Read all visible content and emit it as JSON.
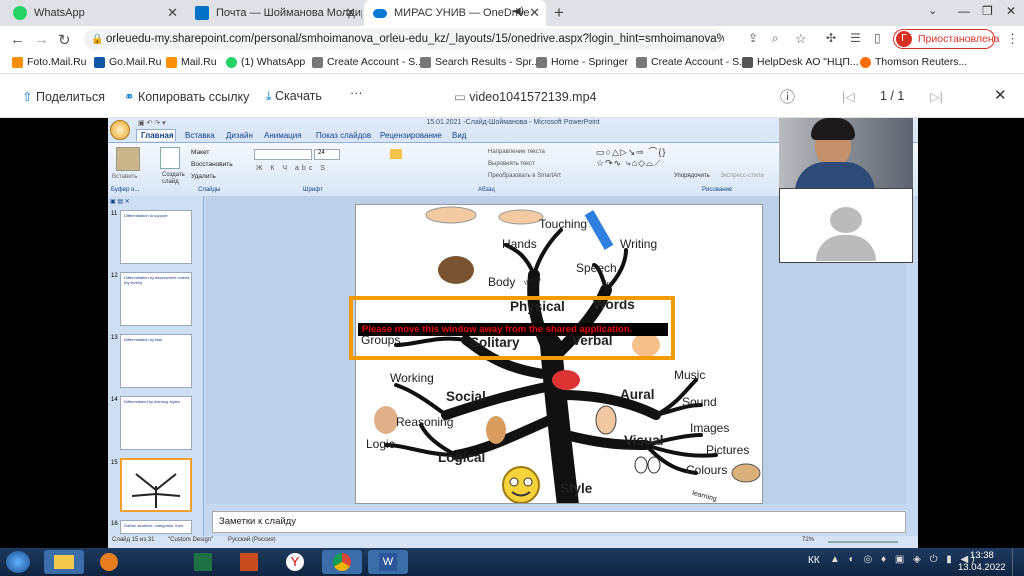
{
  "tabs": [
    {
      "label": "WhatsApp",
      "color": "#25d366"
    },
    {
      "label": "Почта — Шойманова Молдир Е",
      "color": "#0072c6"
    },
    {
      "label": "МИРАС УНИВ — OneDrive",
      "color": "#0078d4"
    }
  ],
  "url": "orleuedu-my.sharepoint.com/personal/smhoimanova_orleu-edu_kz/_layouts/15/onedrive.aspx?login_hint=smhoimanova%40orle...",
  "profile": {
    "initial": "Г",
    "label": "Приостановлена"
  },
  "bookmarks": [
    "Foto.Mail.Ru",
    "Go.Mail.Ru",
    "Mail.Ru",
    "(1) WhatsApp",
    "Create Account - S...",
    "Search Results - Spr...",
    "Home - Springer",
    "Create Account - S...",
    "HelpDesk АО \"НЦП...",
    "Thomson Reuters..."
  ],
  "onedrive": {
    "share": "Поделиться",
    "copy_link": "Копировать ссылку",
    "download": "Скачать",
    "more": "···",
    "filename": "video1041572139.mp4",
    "pager": "1 / 1"
  },
  "ppt": {
    "title": "15.01.2021 -Слайд-Шойманова  -  Microsoft PowerPoint",
    "tabs": [
      "Главная",
      "Вставка",
      "Дизайн",
      "Анимация",
      "Показ слайдов",
      "Рецензирование",
      "Вид"
    ],
    "groups": [
      "Буфер о...",
      "Слайды",
      "Шрифт",
      "Абзац",
      "Рисование"
    ],
    "buttons": [
      "Вставить",
      "Создать слайд",
      "Макет",
      "Восстановить",
      "Удалить",
      "Направление текста",
      "Выровнять текст",
      "Преобразовать в SmartArt",
      "Упорядочить",
      "Экспресс-стили"
    ],
    "font_size": "24",
    "notes": "Заметки к слайду",
    "status": [
      "Слайд 15 из 31",
      "\"Custom Design\"",
      "Русский (Россия)"
    ],
    "zoom": "72%"
  },
  "thumbs": [
    {
      "n": "11",
      "t": "Differentiation to support"
    },
    {
      "n": "12",
      "t": "Differentiation by assessment criteria (by levels)"
    },
    {
      "n": "13",
      "t": "Differentiation by task"
    },
    {
      "n": "14",
      "t": "Differentiated by learning styles"
    },
    {
      "n": "15",
      "t": ""
    },
    {
      "n": "16",
      "t": "Gather students, categorise, then"
    }
  ],
  "slide_words": {
    "touching": "Touching",
    "hands": "Hands",
    "writing": "Writing",
    "body": "Body",
    "speech": "Speech",
    "using1": "using",
    "in": "in",
    "physical": "Physical",
    "words": "Words",
    "groups": "Groups",
    "solitary": "Solitary",
    "verbal": "Verbal",
    "working": "Working",
    "social": "Social",
    "music": "Music",
    "aural": "Aural",
    "sound": "Sound",
    "reasoning": "Reasoning",
    "logic": "Logic",
    "logical": "Logical",
    "images": "Images",
    "visual": "Visual",
    "pictures": "Pictures",
    "colours": "Colours",
    "style": "Style",
    "learning": "learning"
  },
  "warning": "Please move this window away from the shared application.",
  "taskbar": {
    "lang": "КК",
    "time": "13:38",
    "date": "13.04.2022"
  }
}
